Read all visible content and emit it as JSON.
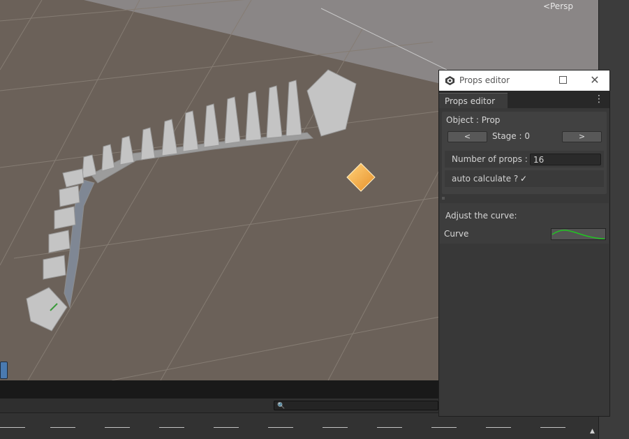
{
  "viewport": {
    "projection_label": "Persp",
    "ground_color": "#6b6159"
  },
  "props_window": {
    "title": "Props editor",
    "tab_label": "Props editor",
    "object_label": "Object : Prop",
    "prev_stage_label": "<",
    "stage_label": "Stage : 0",
    "next_stage_label": ">",
    "props_count_label": "Number of props :",
    "props_count_value": "16",
    "auto_calc_label": "auto calculate ?",
    "auto_calc_checked": true,
    "curve_heading": "Adjust the curve:",
    "curve_label": "Curve",
    "curve_color": "#22c422"
  },
  "title_bar_icons": [
    "app-icon",
    "minimize-icon",
    "maximize-icon",
    "close-icon"
  ],
  "colors": {
    "title_bar": "#ffffff",
    "window_bg": "#383838",
    "gizmo": "#f0a434"
  }
}
